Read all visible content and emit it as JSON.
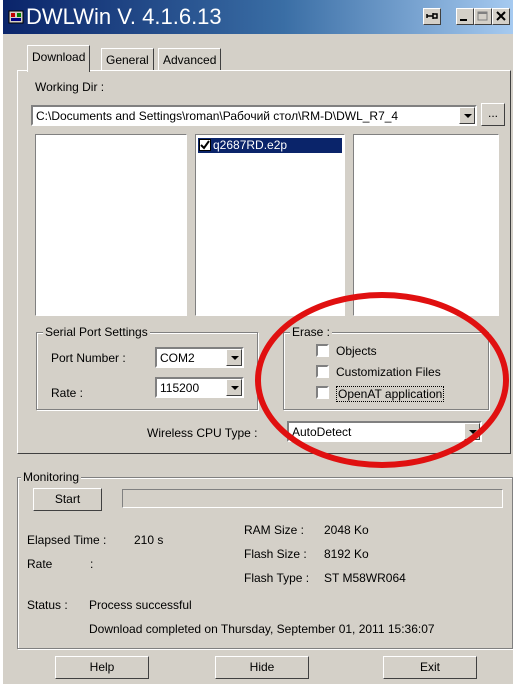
{
  "window": {
    "title": "DWLWin V. 4.1.6.13",
    "accent": "#0a246a",
    "ring_color": "#e01010"
  },
  "titlebar_icons": [
    "pin-icon",
    "minimize-icon",
    "maximize-icon",
    "close-icon"
  ],
  "tabs": [
    {
      "label": "Download",
      "active": true
    },
    {
      "label": "General",
      "active": false
    },
    {
      "label": "Advanced",
      "active": false
    }
  ],
  "download": {
    "working_dir_label": "Working Dir :",
    "working_dir_value": "C:\\Documents and Settings\\roman\\Рабочий стол\\RM-D\\DWL_R7_4",
    "browse_label": "...",
    "file_item": "q2687RD.e2p",
    "serial_group": "Serial Port Settings",
    "port_label": "Port Number :",
    "port_value": "COM2",
    "rate_label": "Rate :",
    "rate_value": "115200",
    "erase_group": "Erase :",
    "erase_options": [
      "Objects",
      "Customization Files",
      "OpenAT application"
    ],
    "cpu_label": "Wireless CPU Type :",
    "cpu_value": "AutoDetect"
  },
  "monitoring": {
    "group": "Monitoring",
    "start_label": "Start",
    "elapsed_label": "Elapsed Time :",
    "elapsed_value": "210 s",
    "rate_label": "Rate",
    "rate_colon": ":",
    "ram_label": "RAM Size :",
    "ram_value": "2048 Ko",
    "flash_label": "Flash Size :",
    "flash_value": "8192 Ko",
    "flash_type_label": "Flash Type :",
    "flash_type_value": "ST M58WR064",
    "status_label": "Status :",
    "status_value": "Process successful",
    "completed_text": "Download completed on Thursday, September 01, 2011 15:36:07"
  },
  "footer": {
    "help": "Help",
    "hide": "Hide",
    "exit": "Exit"
  }
}
